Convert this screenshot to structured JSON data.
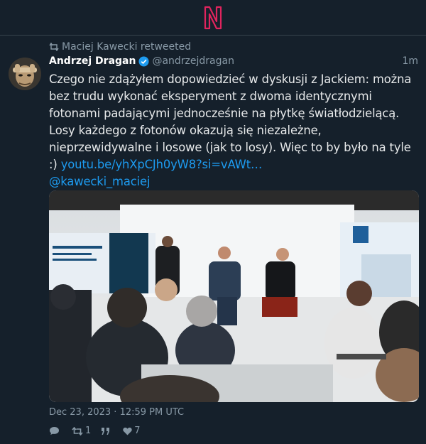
{
  "header": {
    "logo_icon": "nitter-n-logo",
    "logo_color": "#e0245e"
  },
  "retweet": {
    "text": "Maciej Kawecki retweeted",
    "icon": "retweet-icon"
  },
  "tweet": {
    "author_name": "Andrzej Dragan",
    "author_handle": "@andrzejdragan",
    "verified_icon": "verified-badge-icon",
    "time_ago": "1m",
    "text": "Czego nie zdążyłem dopowiedzieć w dyskusji z Jackiem: można bez trudu wykonać eksperyment z dwoma identycznymi fotonami padającymi jednocześnie na płytkę światłodzielącą. Losy każdego z fotonów okazują się niezależne, nieprzewidywalne i losowe (jak to losy). Więc to by było na tyle :) ",
    "link": "youtu.be/yhXpCJh0yW8?si=vAWt…",
    "mention": "@kawecki_maciej",
    "date": "Dec 23, 2023 · 12:59 PM UTC",
    "link_color": "#1d9bf0"
  },
  "stats": {
    "replies": "",
    "retweets": "1",
    "quotes": "",
    "likes": "7"
  }
}
